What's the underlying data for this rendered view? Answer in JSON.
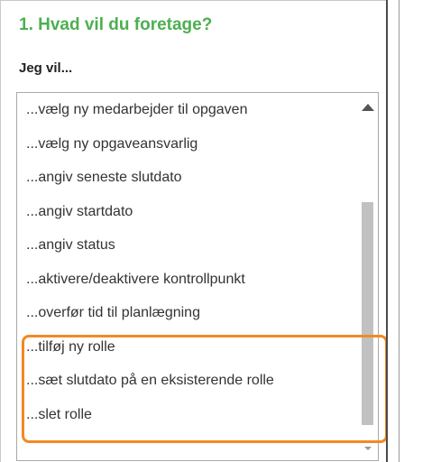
{
  "step": {
    "title": "1. Hvad vil du foretage?"
  },
  "field": {
    "label": "Jeg vil..."
  },
  "actions": [
    "...vælg ny medarbejder til opgaven",
    "...vælg ny opgaveansvarlig",
    "...angiv seneste slutdato",
    "...angiv startdato",
    "...angiv status",
    "...aktivere/deaktivere kontrollpunkt",
    "...overfør tid til planlægning",
    "...tilføj ny rolle",
    "...sæt slutdato på en eksisterende rolle",
    "...slet rolle"
  ],
  "colors": {
    "title_green": "#4caf50",
    "highlight_orange": "#f08a24"
  }
}
